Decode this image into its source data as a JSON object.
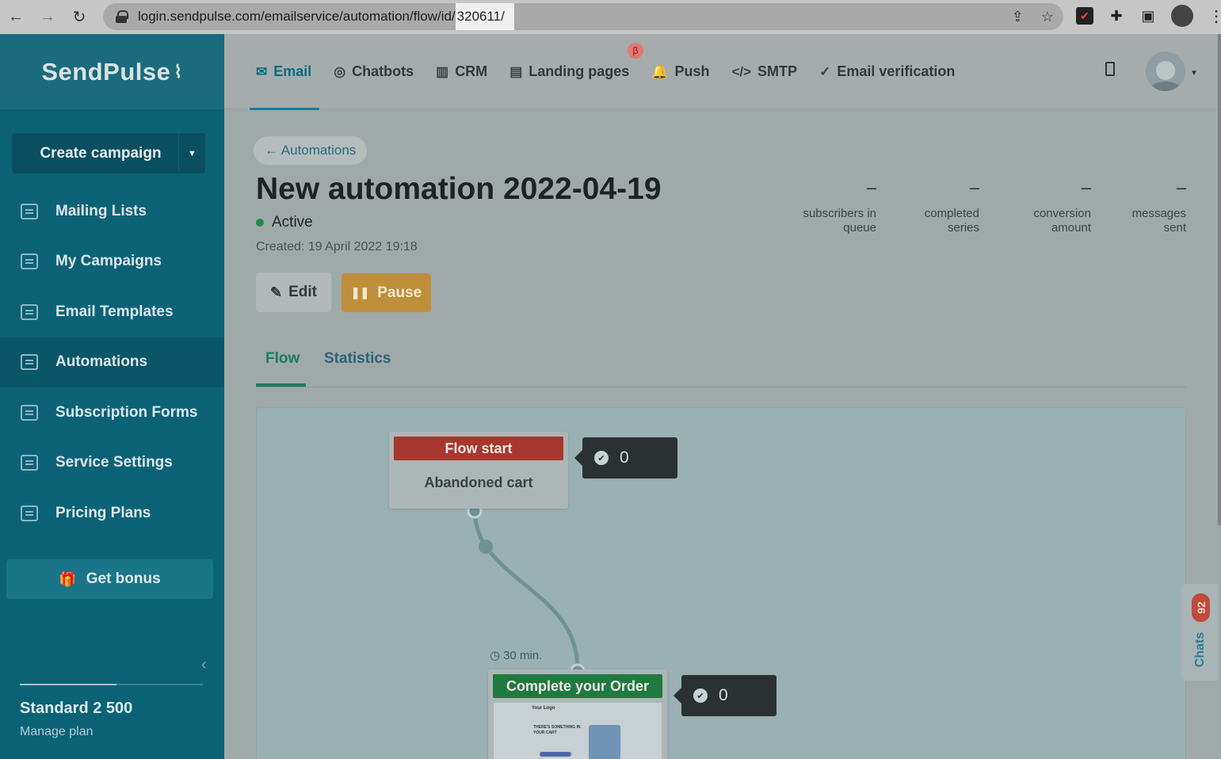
{
  "browser": {
    "url_main": "login.sendpulse.com/emailservice/automation/flow/id/",
    "url_selected": "320611/"
  },
  "sidebar": {
    "logo": "SendPulse",
    "create_campaign": "Create campaign",
    "items": [
      {
        "label": "Mailing Lists",
        "icon": "mailing-lists-icon"
      },
      {
        "label": "My Campaigns",
        "icon": "campaigns-icon"
      },
      {
        "label": "Email Templates",
        "icon": "templates-icon"
      },
      {
        "label": "Automations",
        "icon": "automations-icon"
      },
      {
        "label": "Subscription Forms",
        "icon": "forms-icon"
      },
      {
        "label": "Service Settings",
        "icon": "settings-icon"
      },
      {
        "label": "Pricing Plans",
        "icon": "pricing-icon"
      }
    ],
    "get_bonus": "Get bonus",
    "plan_name": "Standard 2 500",
    "manage_plan": "Manage plan",
    "plan_usage_fraction": 0.53
  },
  "topnav": {
    "tabs": [
      {
        "label": "Email",
        "icon": "mail-icon"
      },
      {
        "label": "Chatbots",
        "icon": "chatbot-icon"
      },
      {
        "label": "CRM",
        "icon": "crm-icon"
      },
      {
        "label": "Landing pages",
        "icon": "landing-icon"
      },
      {
        "label": "Push",
        "icon": "bell-icon"
      },
      {
        "label": "SMTP",
        "icon": "code-icon"
      },
      {
        "label": "Email verification",
        "icon": "check-circle-icon"
      }
    ],
    "beta_badge": "β"
  },
  "main": {
    "back_link": "← Automations",
    "title": "New automation 2022-04-19",
    "status": "Active",
    "created": "Created: 19 April 2022 19:18",
    "edit_label": "Edit",
    "pause_label": "Pause",
    "stats": [
      {
        "value": "–",
        "label1": "subscribers in",
        "label2": "queue"
      },
      {
        "value": "–",
        "label1": "completed",
        "label2": "series"
      },
      {
        "value": "–",
        "label1": "conversion",
        "label2": "amount"
      },
      {
        "value": "–",
        "label1": "messages",
        "label2": "sent"
      }
    ],
    "subtabs": {
      "flow": "Flow",
      "statistics": "Statistics"
    }
  },
  "flow": {
    "start_node": {
      "header": "Flow start",
      "body": "Abandoned cart",
      "count": "0",
      "header_color": "#a8372e"
    },
    "delay": "30 min.",
    "email_node": {
      "header": "Complete your Order",
      "count": "0",
      "header_color": "#1f7a3f",
      "thumb_logo": "Your Logo",
      "thumb_text": "THERE'S SOMETHING IN YOUR CART"
    }
  },
  "chats": {
    "badge": "92",
    "label": "Chats"
  },
  "colors": {
    "sidebar": "#0b6277",
    "accent": "#1b7c95",
    "pause": "#bf8f3b",
    "active": "#1f8a4e"
  }
}
